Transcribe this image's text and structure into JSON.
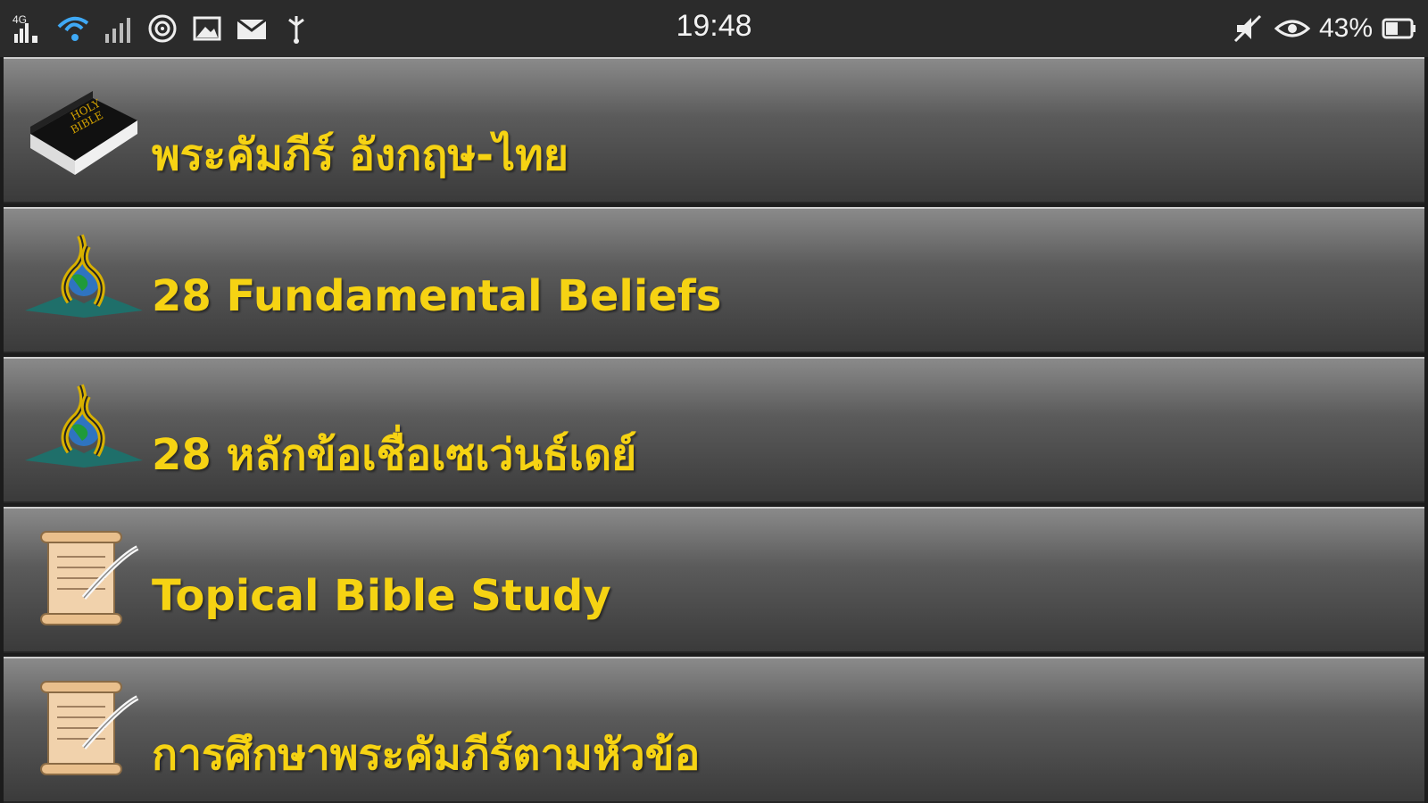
{
  "status_bar": {
    "time": "19:48",
    "battery_percent": "43%",
    "left_icons": [
      "signal-icon",
      "wifi-icon",
      "signal-icon",
      "hotspot-icon",
      "image-icon",
      "mail-icon",
      "usb-icon"
    ],
    "right_icons": [
      "mute-icon",
      "eye-icon",
      "battery-icon"
    ]
  },
  "menu": {
    "items": [
      {
        "label": "พระคัมภีร์ อังกฤษ-ไทย",
        "icon": "holy-bible-book-icon"
      },
      {
        "label": "28 Fundamental Beliefs",
        "icon": "adventist-logo-icon"
      },
      {
        "label": "28 หลักข้อเชื่อเซเว่นธ์เดย์",
        "icon": "adventist-logo-icon"
      },
      {
        "label": "Topical Bible Study",
        "icon": "scroll-quill-icon"
      },
      {
        "label": "การศึกษาพระคัมภีร์ตามหัวข้อ",
        "icon": "scroll-quill-icon"
      }
    ]
  },
  "colors": {
    "label": "#f6d313",
    "status_bar_bg": "#2b2b2b"
  }
}
